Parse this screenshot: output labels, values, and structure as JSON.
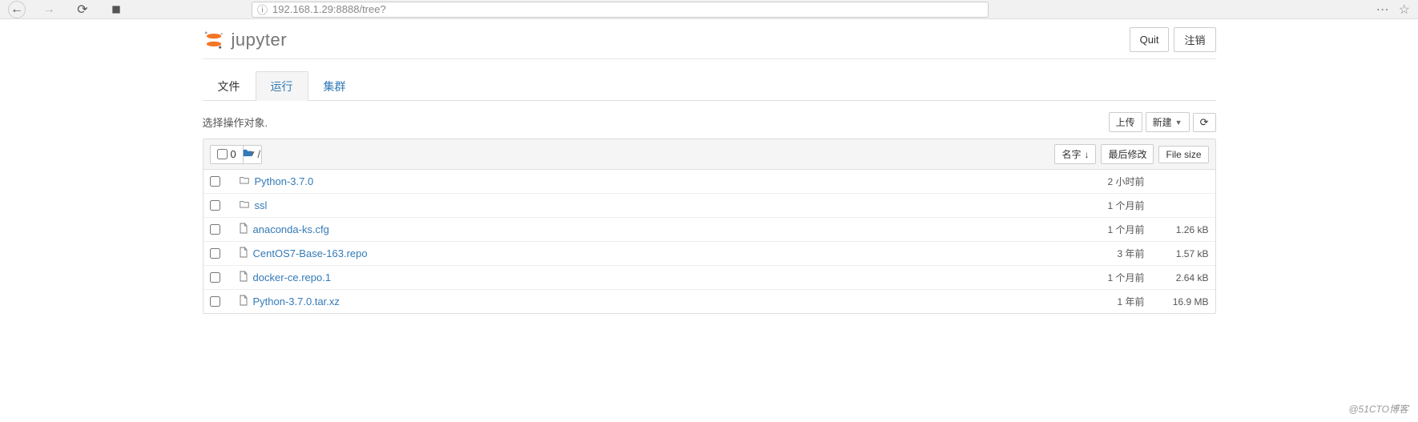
{
  "browser": {
    "url": "192.168.1.29:8888/tree?"
  },
  "header": {
    "logo_text": "jupyter",
    "quit": "Quit",
    "logout": "注销"
  },
  "tabs": {
    "files": "文件",
    "running": "运行",
    "clusters": "集群"
  },
  "toolbar": {
    "desc": "选择操作对象.",
    "upload": "上传",
    "new": "新建",
    "select_count": "0",
    "breadcrumb": "/"
  },
  "columns": {
    "name": "名字",
    "modified": "最后修改",
    "size": "File size"
  },
  "files": [
    {
      "type": "folder",
      "name": "Python-3.7.0",
      "modified": "2 小时前",
      "size": ""
    },
    {
      "type": "folder",
      "name": "ssl",
      "modified": "1 个月前",
      "size": ""
    },
    {
      "type": "file",
      "name": "anaconda-ks.cfg",
      "modified": "1 个月前",
      "size": "1.26 kB"
    },
    {
      "type": "file",
      "name": "CentOS7-Base-163.repo",
      "modified": "3 年前",
      "size": "1.57 kB"
    },
    {
      "type": "file",
      "name": "docker-ce.repo.1",
      "modified": "1 个月前",
      "size": "2.64 kB"
    },
    {
      "type": "file",
      "name": "Python-3.7.0.tar.xz",
      "modified": "1 年前",
      "size": "16.9 MB"
    }
  ],
  "watermark": "@51CTO博客"
}
